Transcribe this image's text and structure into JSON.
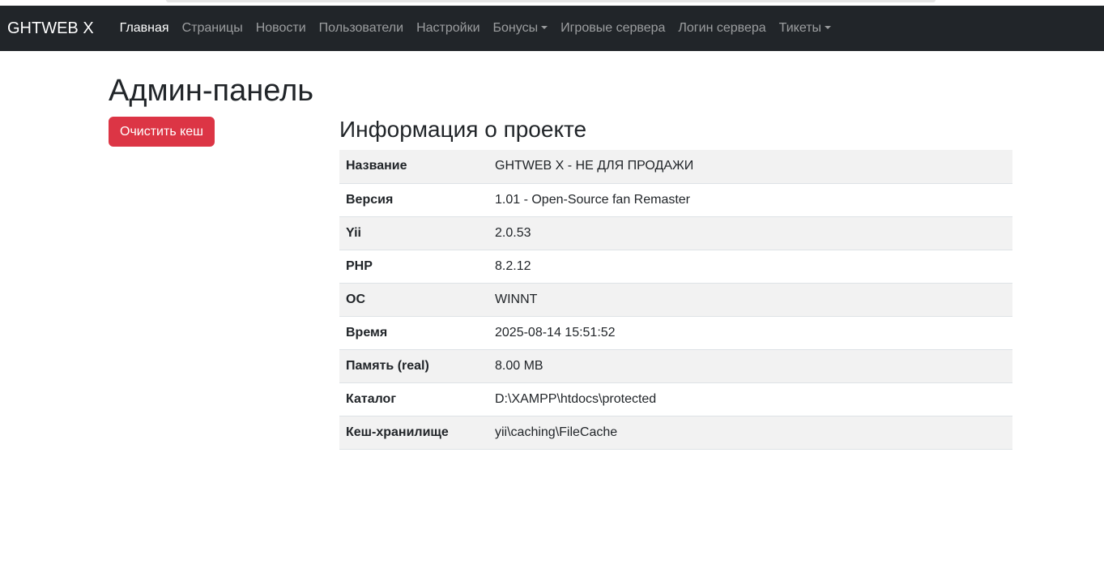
{
  "navbar": {
    "brand": "GHTWEB X",
    "items": [
      {
        "label": "Главная",
        "active": true,
        "dropdown": false
      },
      {
        "label": "Страницы",
        "active": false,
        "dropdown": false
      },
      {
        "label": "Новости",
        "active": false,
        "dropdown": false
      },
      {
        "label": "Пользователи",
        "active": false,
        "dropdown": false
      },
      {
        "label": "Настройки",
        "active": false,
        "dropdown": false
      },
      {
        "label": "Бонусы",
        "active": false,
        "dropdown": true
      },
      {
        "label": "Игровые сервера",
        "active": false,
        "dropdown": false
      },
      {
        "label": "Логин сервера",
        "active": false,
        "dropdown": false
      },
      {
        "label": "Тикеты",
        "active": false,
        "dropdown": true
      }
    ]
  },
  "page": {
    "title": "Админ-панель",
    "clear_cache_button": "Очистить кеш"
  },
  "info": {
    "title": "Информация о проекте",
    "rows": [
      {
        "key": "Название",
        "value": "GHTWEB X - НЕ ДЛЯ ПРОДАЖИ"
      },
      {
        "key": "Версия",
        "value": "1.01 - Open-Source fan Remaster"
      },
      {
        "key": "Yii",
        "value": "2.0.53"
      },
      {
        "key": "PHP",
        "value": "8.2.12"
      },
      {
        "key": "ОС",
        "value": "WINNT"
      },
      {
        "key": "Время",
        "value": "2025-08-14 15:51:52"
      },
      {
        "key": "Память (real)",
        "value": "8.00 MB"
      },
      {
        "key": "Каталог",
        "value": "D:\\XAMPP\\htdocs\\protected"
      },
      {
        "key": "Кеш-хранилище",
        "value": "yii\\caching\\FileCache"
      }
    ]
  },
  "colors": {
    "navbar_bg": "#212529",
    "danger": "#dc3545",
    "stripe": "#f2f2f2"
  }
}
